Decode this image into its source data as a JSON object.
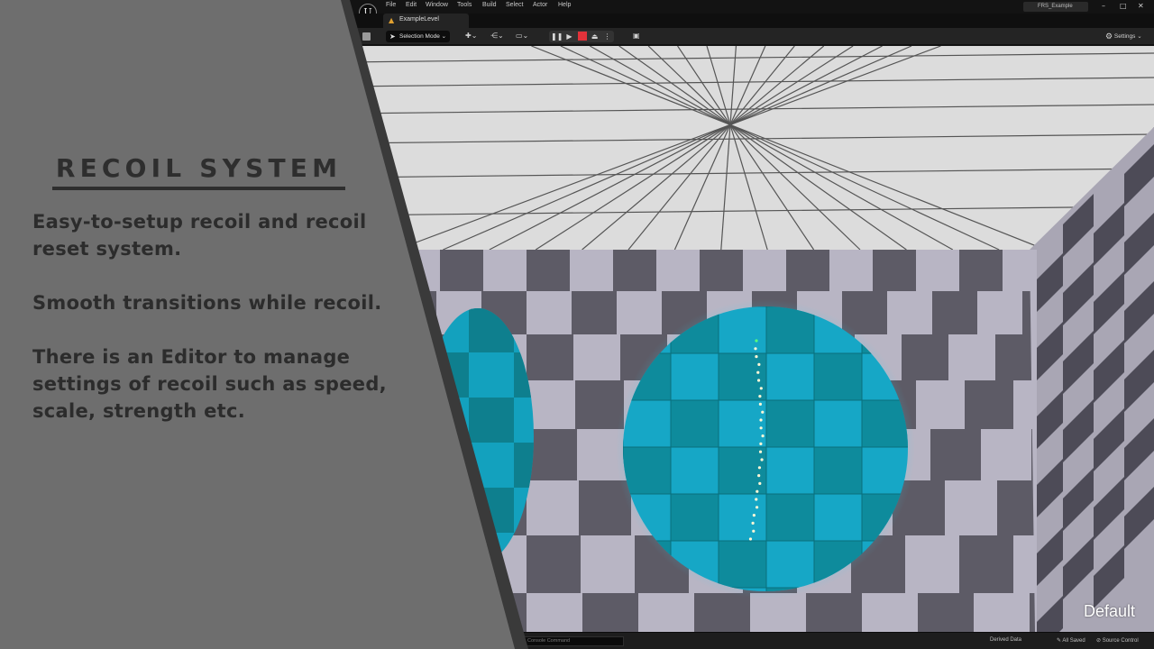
{
  "menu": {
    "items": [
      "File",
      "Edit",
      "Window",
      "Tools",
      "Build",
      "Select",
      "Actor",
      "Help"
    ],
    "project_name": "FRS_Example",
    "window_controls": [
      "–",
      "□",
      "✕"
    ]
  },
  "tabs": {
    "level_tab_label": "ExampleLevel"
  },
  "toolbar": {
    "selection_mode_label": "Selection Mode",
    "settings_label": "Settings"
  },
  "viewport": {
    "view_mode_label": "Default"
  },
  "statusbar": {
    "console_placeholder": "Console Command",
    "derived_data_label": "Derived Data",
    "all_saved_label": "All Saved",
    "source_control_label": "Source Control"
  },
  "info_panel": {
    "heading": "RECOIL SYSTEM",
    "para1_line1": "Easy-to-setup recoil and recoil",
    "para1_line2": "reset system.",
    "para2_line1": "Smooth transitions while recoil.",
    "para3_line1": "There is an Editor to manage",
    "para3_line2": "settings of recoil such as speed,",
    "para3_line3": "scale, strength etc."
  },
  "colors": {
    "panel_bg": "#6e6e6e",
    "panel_border": "#3a3a3a",
    "target_light": "#16a7c6",
    "target_dark": "#0e8b9c",
    "stop_red": "#e2323a"
  }
}
